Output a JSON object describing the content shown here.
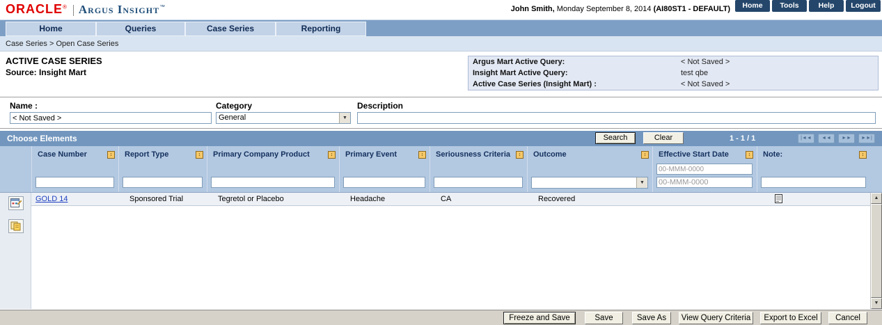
{
  "header": {
    "oracle": "ORACLE",
    "registered": "®",
    "product": "Argus Insight",
    "tm": "™",
    "user_name": "John Smith,",
    "user_date": " Monday September 8, 2014 ",
    "user_env": "(AI80ST1 - DEFAULT)",
    "nav": [
      {
        "label": "Home"
      },
      {
        "label": "Tools"
      },
      {
        "label": "Help"
      },
      {
        "label": "Logout"
      }
    ]
  },
  "tabs": [
    {
      "label": "Home"
    },
    {
      "label": "Queries"
    },
    {
      "label": "Case Series"
    },
    {
      "label": "Reporting"
    }
  ],
  "breadcrumb": "Case Series  >  Open Case Series",
  "page": {
    "title": "ACTIVE CASE SERIES",
    "subtitle": "Source: Insight Mart",
    "query_info": [
      {
        "label": "Argus Mart Active Query:",
        "value": "< Not Saved >"
      },
      {
        "label": "Insight Mart Active Query:",
        "value": "test qbe"
      },
      {
        "label": "Active Case Series (Insight Mart) :",
        "value": "< Not Saved >"
      }
    ]
  },
  "form": {
    "name_label": "Name :",
    "name_value": "< Not Saved >",
    "category_label": "Category",
    "category_value": "General",
    "description_label": "Description",
    "description_value": ""
  },
  "toolbar": {
    "title": "Choose Elements",
    "search_label": "Search",
    "clear_label": "Clear",
    "pagination": "1 - 1 / 1",
    "pager": [
      {
        "name": "first-page",
        "glyph": "|◄◄"
      },
      {
        "name": "previous-page",
        "glyph": "◄◄"
      },
      {
        "name": "next-page",
        "glyph": "►►"
      },
      {
        "name": "last-page",
        "glyph": "►►|"
      }
    ]
  },
  "table": {
    "columns": [
      {
        "label": "Case Number"
      },
      {
        "label": "Report Type"
      },
      {
        "label": "Primary Company Product"
      },
      {
        "label": "Primary Event"
      },
      {
        "label": "Seriousness Criteria"
      },
      {
        "label": "Outcome"
      },
      {
        "label": "Effective Start Date"
      },
      {
        "label": "Note:"
      }
    ],
    "sort_glyph": "↕",
    "date_format": "00-MMM-0000",
    "rows": [
      {
        "case_number": "GOLD 14",
        "report_type": "Sponsored Trial",
        "primary_company_product": "Tegretol or Placebo",
        "primary_event": "Headache",
        "seriousness_criteria": "CA",
        "outcome": "Recovered",
        "effective_start_date": "",
        "has_note": "note-icon"
      }
    ]
  },
  "scrollbar": {
    "up_glyph": "▲",
    "down_glyph": "▼"
  },
  "footer": {
    "buttons": [
      {
        "label": "Freeze and Save"
      },
      {
        "label": "Save"
      },
      {
        "label": "Save As"
      },
      {
        "label": "View Query Criteria"
      },
      {
        "label": "Export to Excel"
      },
      {
        "label": "Cancel"
      }
    ]
  }
}
